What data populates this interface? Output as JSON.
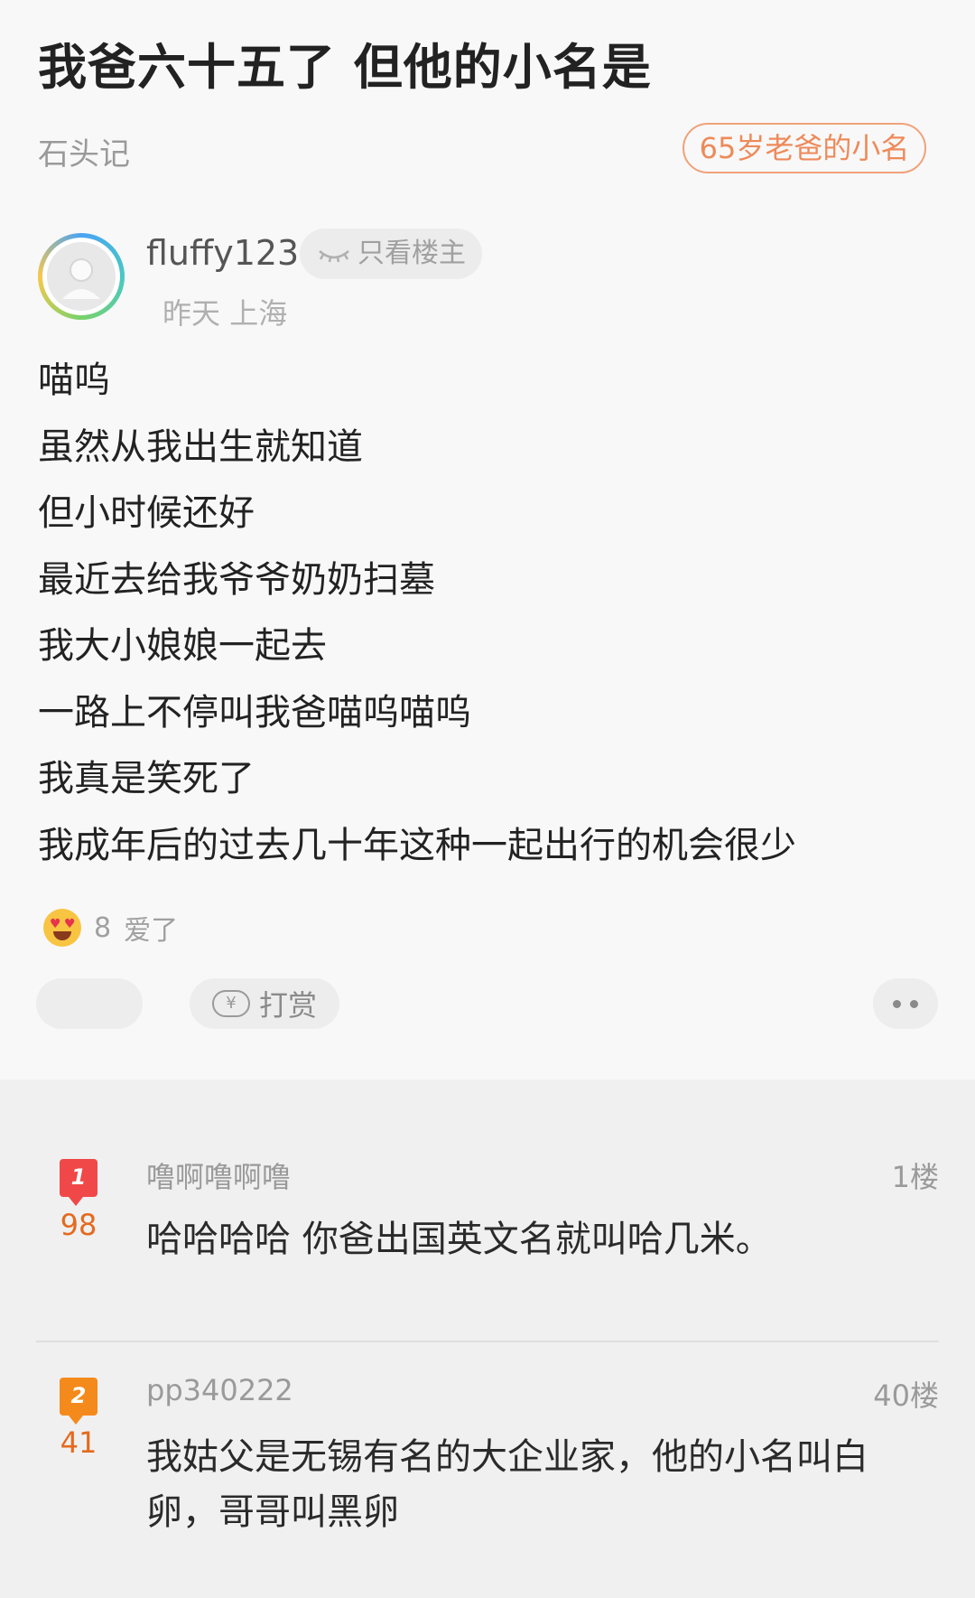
{
  "post": {
    "title": "我爸六十五了 但他的小名是",
    "group": "石头记",
    "tag": "65岁老爸的小名",
    "author": {
      "name": "fluffy123",
      "only_op_label": "只看楼主",
      "time": "昨天",
      "location": "上海"
    },
    "lines": [
      "喵呜",
      "虽然从我出生就知道",
      "但小时候还好",
      "最近去给我爷爷奶奶扫墓",
      "我大小娘娘一起去",
      "一路上不停叫我爸喵呜喵呜",
      "我真是笑死了",
      "我成年后的过去几十年这种一起出行的机会很少"
    ],
    "reaction": {
      "count": "8",
      "label": "爱了"
    },
    "reward_label": "打赏",
    "yen_symbol": "¥"
  },
  "comments": [
    {
      "rank": "1",
      "likes": "98",
      "user": "噜啊噜啊噜",
      "floor": "1楼",
      "text": "哈哈哈哈 你爸出国英文名就叫哈几米。"
    },
    {
      "rank": "2",
      "likes": "41",
      "user": "pp340222",
      "floor": "40楼",
      "text": "我姑父是无锡有名的大企业家，他的小名叫白卵，哥哥叫黑卵"
    }
  ],
  "colors": {
    "tag": "#ee8a5a",
    "rank1": "#f04848",
    "rank2": "#f58a1c",
    "likes": "#e46a1e"
  }
}
